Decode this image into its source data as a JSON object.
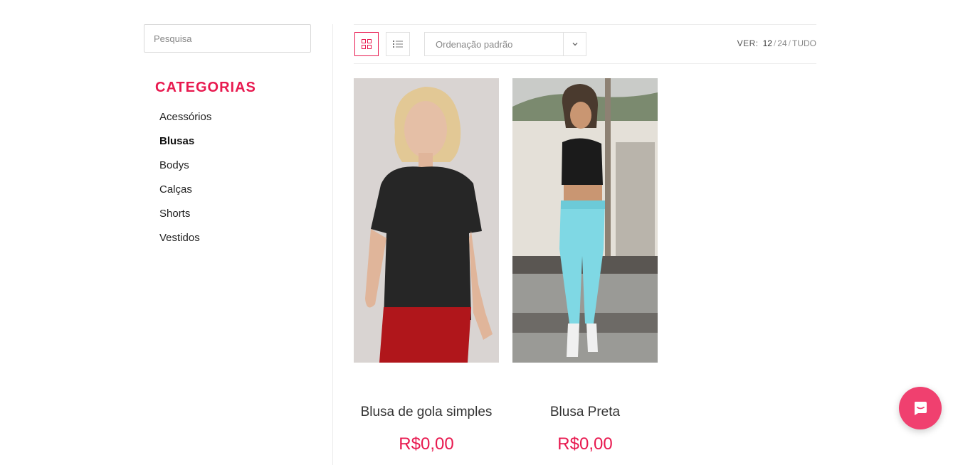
{
  "search": {
    "placeholder": "Pesquisa"
  },
  "categories": {
    "title": "CATEGORIAS",
    "items": [
      {
        "label": "Acessórios"
      },
      {
        "label": "Blusas",
        "active": true
      },
      {
        "label": "Bodys"
      },
      {
        "label": "Calças"
      },
      {
        "label": "Shorts"
      },
      {
        "label": "Vestidos"
      }
    ]
  },
  "toolbar": {
    "sort_selected": "Ordenação padrão",
    "ver_label": "VER:",
    "ver_options": [
      "12",
      "24",
      "TUDO"
    ],
    "ver_selected": "12"
  },
  "products": [
    {
      "name": "Blusa de gola simples",
      "price": "R$0,00"
    },
    {
      "name": "Blusa Preta",
      "price": "R$0,00"
    }
  ],
  "colors": {
    "accent": "#e8194f",
    "chat": "#f0406f"
  },
  "icons": [
    "grid-view-icon",
    "list-view-icon",
    "chevron-down-icon",
    "chat-icon"
  ]
}
